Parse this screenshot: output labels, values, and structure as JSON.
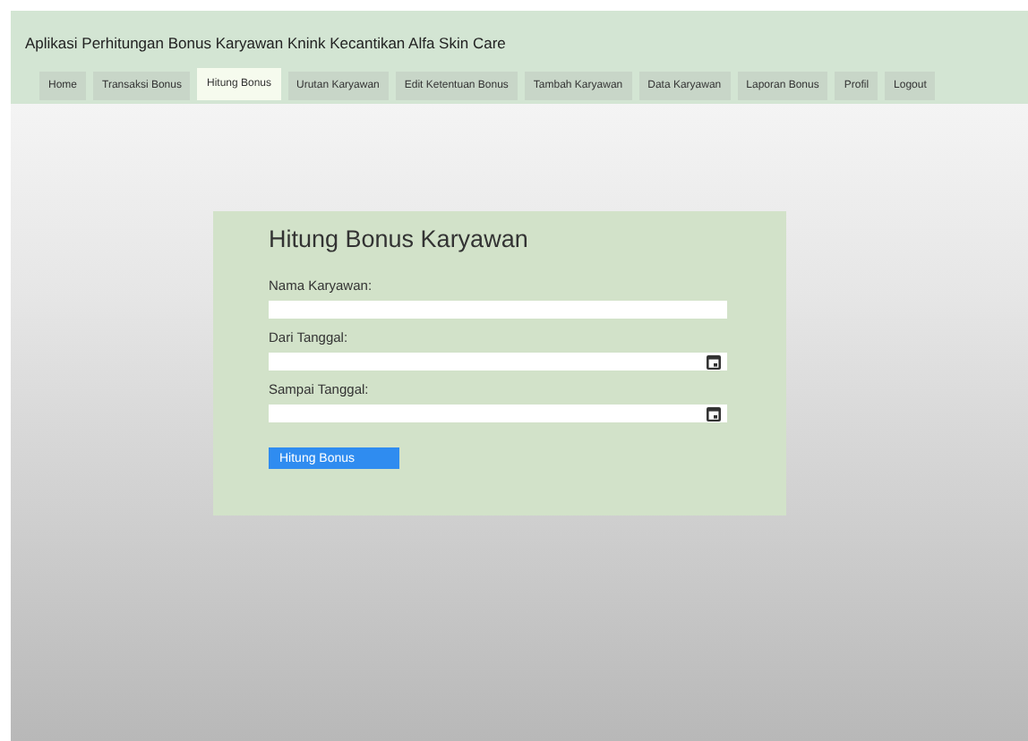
{
  "header": {
    "title": "Aplikasi Perhitungan Bonus Karyawan Knink Kecantikan Alfa Skin Care"
  },
  "nav": [
    {
      "label": "Home",
      "selected": false
    },
    {
      "label": "Transaksi Bonus",
      "selected": false
    },
    {
      "label": "Hitung Bonus",
      "selected": true
    },
    {
      "label": "Urutan Karyawan",
      "selected": false
    },
    {
      "label": "Edit Ketentuan Bonus",
      "selected": false
    },
    {
      "label": "Tambah Karyawan",
      "selected": false
    },
    {
      "label": "Data Karyawan",
      "selected": false
    },
    {
      "label": "Laporan Bonus",
      "selected": false
    },
    {
      "label": "Profil",
      "selected": false
    },
    {
      "label": "Logout",
      "selected": false
    }
  ],
  "form": {
    "title": "Hitung Bonus Karyawan",
    "fields": [
      {
        "label": "Nama Karyawan:",
        "kind": "text"
      },
      {
        "label": "Dari Tanggal:",
        "kind": "date"
      },
      {
        "label": "Sampai Tanggal:",
        "kind": "date"
      }
    ],
    "button": "Hitung Bonus"
  }
}
